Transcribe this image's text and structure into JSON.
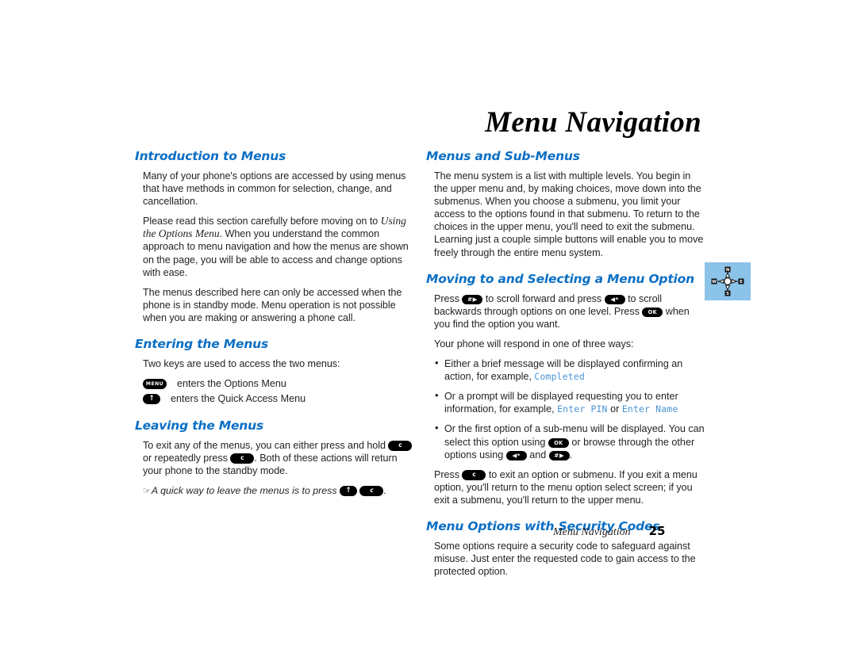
{
  "document": {
    "title": "Menu Navigation",
    "page_number": "25",
    "footer_chapter": "Menu Navigation"
  },
  "colors": {
    "heading_blue": "#0b6fc4",
    "lcd_blue": "#4a93d4",
    "icon_box_blue": "#8cc3e9",
    "body_text": "#231f20"
  },
  "keys": {
    "menu": "MENU",
    "up": "⬆",
    "up_glyph": "↑",
    "clear": "c",
    "ok": "OK",
    "hash_forward": "#",
    "hash_arrow": "▶",
    "star_back": "*",
    "star_arrow": "◀",
    "hand": "☞"
  },
  "left_column": {
    "sections": [
      {
        "heading": "Introduction to Menus",
        "paragraphs": [
          "Many of your phone's options are accessed by using menus that have methods in common for selection, change, and cancellation.",
          "Please read this section carefully before moving on to Using the Options Menu. When you understand the common approach to menu navigation and how the menus are shown on the page, you will be able to access and change options with ease.",
          "The menus described here can only be accessed when the phone is in standby mode. Menu operation is not possible when you are making or answering a phone call."
        ],
        "paragraph2_parts": {
          "before": "Please read this section carefully before moving on to ",
          "italic": "Using the Options Menu",
          "after": ". When you understand the common approach to menu navigation and how the menus are shown on the page, you will be able to access and change options with ease."
        }
      },
      {
        "heading": "Entering the Menus",
        "intro": "Two keys are used to access the two menus:",
        "key_rows": [
          {
            "key": "MENU",
            "label": "enters the Options Menu"
          },
          {
            "key": "↑",
            "label": "enters the Quick Access Menu"
          }
        ]
      },
      {
        "heading": "Leaving the Menus",
        "paragraph_parts": {
          "p1a": "To exit any of the menus, you can either press and hold ",
          "p1b": " or repeatedly press ",
          "p1c": ". Both of these actions will return your phone to the standby mode."
        },
        "tip": {
          "before": "A quick way to leave the menus is to press ",
          "after": "."
        }
      }
    ]
  },
  "right_column": {
    "sections": [
      {
        "heading": "Menus and Sub-Menus",
        "paragraphs": [
          "The menu system is a list with multiple levels. You begin in the upper menu and, by making choices, move down into the submenus. When you choose a submenu, you limit your access to the options found in that submenu. To return to the choices in the upper menu, you'll need to exit the submenu. Learning just a couple simple buttons will enable you to move freely through the entire menu system."
        ]
      },
      {
        "heading": "Moving to and Selecting a Menu Option",
        "intro_parts": {
          "a": "Press ",
          "b": " to scroll forward and press ",
          "c": " to scroll backwards through options on one level. Press ",
          "d": " when you find the option you want."
        },
        "respond_line": "Your phone will respond in one of three ways:",
        "bullets": [
          {
            "text_before": "Either a brief message will be displayed confirming an action, for example, ",
            "lcd": "Completed",
            "text_after": ""
          },
          {
            "text_before": "Or a prompt will be displayed requesting you to enter information, for example, ",
            "lcd": "Enter PIN",
            "mid": " or ",
            "lcd2": "Enter Name",
            "text_after": ""
          },
          {
            "text_before": "Or the first option of a sub-menu will be displayed. You can select this option using ",
            "text_mid": " or browse through the other options using ",
            "text_and": " and ",
            "text_after": "."
          }
        ],
        "closing_parts": {
          "a": "Press ",
          "b": " to exit an option or submenu. If you exit a menu option, you'll return to the menu option select screen; if you exit a submenu, you'll return to the upper menu."
        }
      },
      {
        "heading": "Menu Options with Security Codes",
        "paragraphs": [
          "Some options require a security code to safeguard against misuse. Just enter the requested code to gain access to the protected option."
        ]
      }
    ]
  },
  "compass_icon": {
    "name": "compass-navigation-icon",
    "north": "N",
    "south": "S",
    "east": "E",
    "west": "W"
  }
}
